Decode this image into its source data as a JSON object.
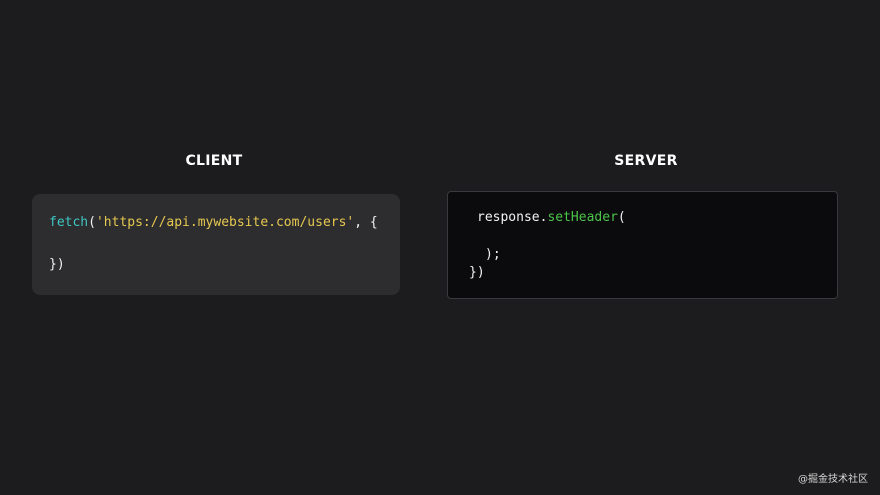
{
  "client": {
    "heading": "CLIENT",
    "code": {
      "line1": {
        "fn": "fetch",
        "open": "(",
        "url": "'https://api.mywebsite.com/users'",
        "rest": ", {"
      },
      "line2": "})"
    }
  },
  "server": {
    "heading": "SERVER",
    "code": {
      "line1": {
        "obj": "response.",
        "method": "setHeader",
        "open": "("
      },
      "line2": ");",
      "line3": "})"
    }
  },
  "colors": {
    "background": "#1c1c1e",
    "client_panel": "#2d2d30",
    "server_panel": "#0b0b0d",
    "function_cyan": "#3ec6c2",
    "string_yellow": "#e6c84f",
    "method_green": "#4cc44a"
  },
  "watermark": "@掘金技术社区"
}
